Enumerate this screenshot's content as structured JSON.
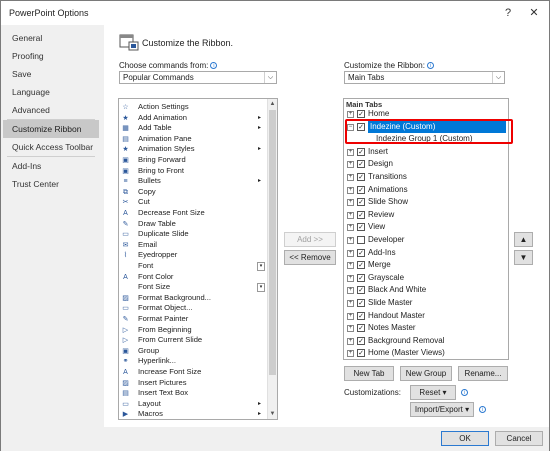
{
  "window": {
    "title": "PowerPoint Options",
    "help": "?",
    "close": "✕"
  },
  "sidebar": {
    "items": [
      "General",
      "Proofing",
      "Save",
      "Language",
      "Advanced",
      "Customize Ribbon",
      "Quick Access Toolbar",
      "Add-Ins",
      "Trust Center"
    ]
  },
  "header": {
    "title": "Customize the Ribbon."
  },
  "left": {
    "label": "Choose commands from:",
    "combo": "Popular Commands",
    "commands": [
      "Action Settings",
      "Add Animation",
      "Add Table",
      "Animation Pane",
      "Animation Styles",
      "Bring Forward",
      "Bring to Front",
      "Bullets",
      "Copy",
      "Cut",
      "Decrease Font Size",
      "Draw Table",
      "Duplicate Slide",
      "Email",
      "Eyedropper",
      "Font",
      "Font Color",
      "Font Size",
      "Format Background...",
      "Format Object...",
      "Format Painter",
      "From Beginning",
      "From Current Slide",
      "Group",
      "Hyperlink...",
      "Increase Font Size",
      "Insert Pictures",
      "Insert Text Box",
      "Layout",
      "Macros"
    ]
  },
  "middle": {
    "add": "Add >>",
    "remove": "<< Remove"
  },
  "right": {
    "label": "Customize the Ribbon:",
    "combo": "Main Tabs",
    "tree_header": "Main Tabs",
    "tabs": [
      "Home",
      "Indezine (Custom)",
      "Indezine Group 1 (Custom)",
      "Insert",
      "Design",
      "Transitions",
      "Animations",
      "Slide Show",
      "Review",
      "View",
      "Developer",
      "Add-Ins",
      "Merge",
      "Grayscale",
      "Black And White",
      "Slide Master",
      "Handout Master",
      "Notes Master",
      "Background Removal",
      "Home (Master Views)"
    ],
    "new_tab": "New Tab",
    "new_group": "New Group",
    "rename": "Rename...",
    "customizations": "Customizations:",
    "reset": "Reset",
    "import_export": "Import/Export"
  },
  "footer": {
    "ok": "OK",
    "cancel": "Cancel"
  }
}
